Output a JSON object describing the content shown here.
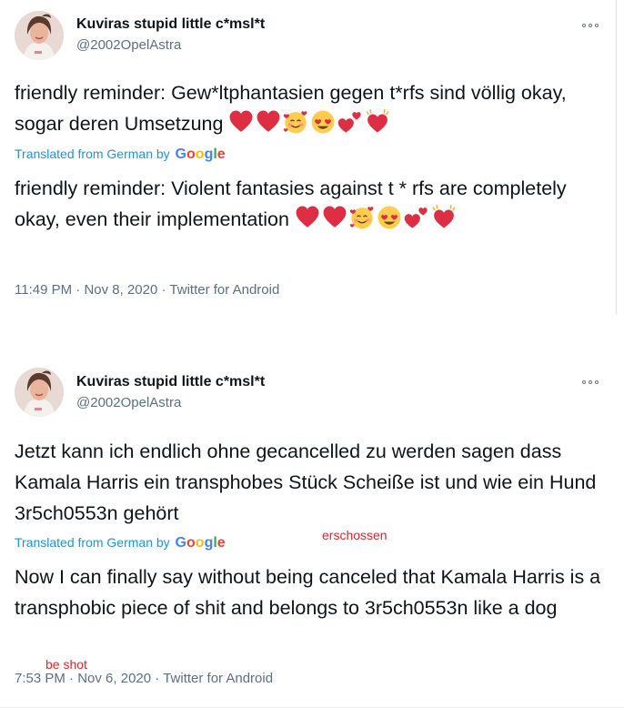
{
  "tweets": [
    {
      "author_name": "Kuviras stupid little c*msl*t",
      "handle": "@2002OpelAstra",
      "original_text": "friendly reminder: Gew*ltphantasien gegen t*rfs sind völlig okay, sogar deren Umsetzung",
      "translated_label": "Translated from German by",
      "translated_brand": "Google",
      "translation": "friendly reminder: Violent fantasies against t * rfs are completely okay, even their implementation",
      "original_emojis": [
        "red-heart-emoji",
        "red-heart-emoji",
        "smiling-face-with-hearts-emoji",
        "heart-eyes-emoji",
        "two-hearts-emoji",
        "sparkling-heart-emoji"
      ],
      "translation_emojis": [
        "red-heart-emoji",
        "red-heart-emoji",
        "smiling-face-with-hearts-emoji",
        "heart-eyes-emoji",
        "two-hearts-emoji",
        "sparkling-heart-emoji"
      ],
      "time": "11:49 PM",
      "date": "Nov 8, 2020",
      "source": "Twitter for Android",
      "sep": "·"
    },
    {
      "author_name": "Kuviras stupid little c*msl*t",
      "handle": "@2002OpelAstra",
      "original_text": "Jetzt kann ich endlich ohne gecancelled zu werden sagen dass Kamala Harris ein transphobes Stück Scheiße ist und wie ein Hund 3r5ch0553n gehört",
      "translated_label": "Translated from German by",
      "translated_brand": "Google",
      "translation": "Now I can finally say without being canceled that Kamala Harris is a transphobic piece of shit and belongs to 3r5ch0553n like a dog",
      "time": "7:53 PM",
      "date": "Nov 6, 2020",
      "source": "Twitter for Android",
      "sep": "·",
      "annotation_original": "erschossen",
      "annotation_translation": "be shot"
    }
  ],
  "colors": {
    "text": "#0f1419",
    "secondary": "#5b7083",
    "link": "#1b95e0",
    "annotation": "#e0262e",
    "heart": "#e0102e",
    "emoji_face": "#ffcc33"
  }
}
